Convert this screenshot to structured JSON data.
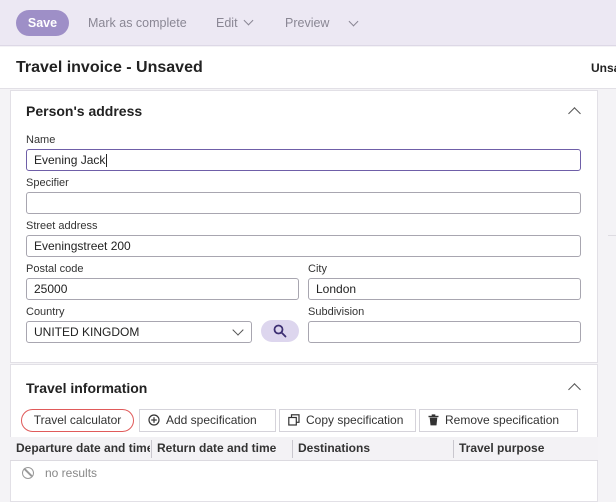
{
  "toolbar": {
    "save": "Save",
    "mark_complete": "Mark as complete",
    "edit": "Edit",
    "preview": "Preview"
  },
  "page": {
    "title": "Travel invoice - Unsaved",
    "status_partial": "Unsa"
  },
  "address": {
    "title": "Person's address",
    "name_label": "Name",
    "name_value": "Evening Jack",
    "specifier_label": "Specifier",
    "specifier_value": "",
    "street_label": "Street address",
    "street_value": "Eveningstreet 200",
    "postal_label": "Postal code",
    "postal_value": "25000",
    "city_label": "City",
    "city_value": "London",
    "country_label": "Country",
    "country_value": "UNITED KINGDOM",
    "subdivision_label": "Subdivision",
    "subdivision_value": ""
  },
  "travel": {
    "title": "Travel information",
    "buttons": {
      "calculator": "Travel calculator",
      "add": "Add specification",
      "copy": "Copy specification",
      "remove": "Remove specification"
    },
    "columns": [
      "Departure date and time",
      "Return date and time",
      "Destinations",
      "Travel purpose"
    ],
    "empty_text": "no results"
  },
  "icons": {
    "add": "plus-circle-icon",
    "copy": "copy-icon",
    "remove": "trash-icon",
    "search": "search-icon",
    "collapse": "chevron-up-icon",
    "empty": "ban-icon"
  },
  "colors": {
    "primary": "#9e8fc7",
    "toolbar_bg": "#ece8f3",
    "highlight": "#e05a5a"
  }
}
